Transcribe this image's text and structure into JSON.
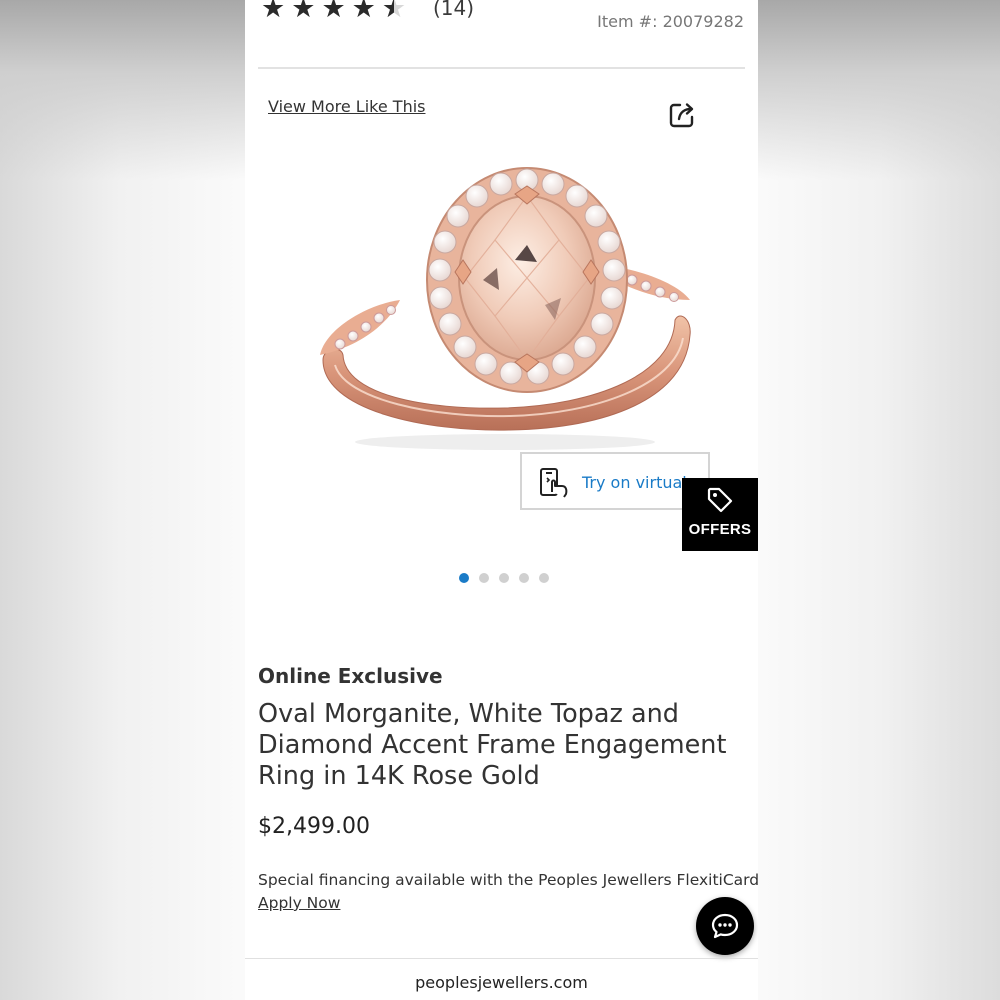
{
  "rating": {
    "stars": 4.5,
    "review_count": "(14)"
  },
  "item_number": "Item #: 20079282",
  "view_more": "View More Like This",
  "icons": {
    "share": "share-icon",
    "try_on": "phone-hand-icon",
    "offers": "tag-icon",
    "chat": "chat-bubble-icon",
    "star": "star-icon"
  },
  "try_on_label": "Try on virtual",
  "offers_label": "OFFERS",
  "carousel": {
    "total": 5,
    "active": 1
  },
  "product": {
    "badge": "Online Exclusive",
    "title": "Oval Morganite, White Topaz and Diamond Accent Frame Engagement Ring in 14K Rose Gold",
    "price": "$2,499.00",
    "financing": "Special financing available with the Peoples Jewellers FlexitiCard.",
    "apply_link": "Apply Now"
  },
  "footer_url": "peoplesjewellers.com",
  "colors": {
    "accent": "#1a7bc7",
    "rose_gold": "#e0a588",
    "black": "#000000"
  }
}
